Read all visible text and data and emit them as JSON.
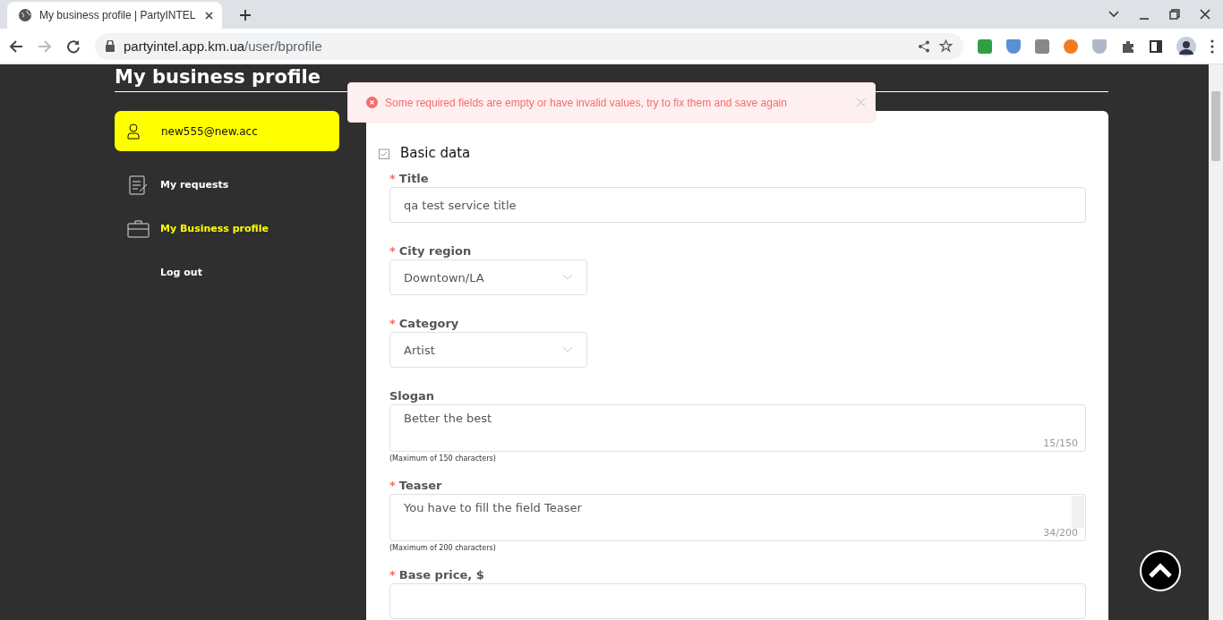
{
  "browser": {
    "tabs": [
      {
        "title": "My business profile | PartyINTEL",
        "selected": true
      }
    ],
    "url": {
      "host": "partyintel.app.km.ua",
      "path": "/user/bprofile"
    }
  },
  "page": {
    "heading": "My business profile"
  },
  "sidebar": {
    "account": "new555@new.acc",
    "items": [
      {
        "label": "My requests",
        "selected": false
      },
      {
        "label": "My Business profile",
        "selected": true
      },
      {
        "label": "Log out",
        "selected": false
      }
    ]
  },
  "toast": {
    "message": "Some required fields are empty or have invalid values, try to fix them and save again"
  },
  "form": {
    "section": "Basic data",
    "required_marker": "*",
    "fields": [
      {
        "kind": "text",
        "label": "Title",
        "required": true,
        "value": "qa test service title"
      },
      {
        "kind": "select",
        "label": "City region",
        "required": true,
        "value": "Downtown/LA"
      },
      {
        "kind": "select",
        "label": "Category",
        "required": true,
        "value": "Artist"
      },
      {
        "kind": "textarea",
        "label": "Slogan",
        "required": false,
        "value": "Better the best",
        "counter": "15/150",
        "hint": "(Maximum of 150 characters)",
        "scrollbar": false
      },
      {
        "kind": "textarea",
        "label": "Teaser",
        "required": true,
        "value": "You have to fill the field Teaser",
        "counter": "34/200",
        "hint": "(Maximum of 200 characters)",
        "scrollbar": true
      },
      {
        "kind": "text",
        "label": "Base price, $",
        "required": true
      }
    ]
  }
}
